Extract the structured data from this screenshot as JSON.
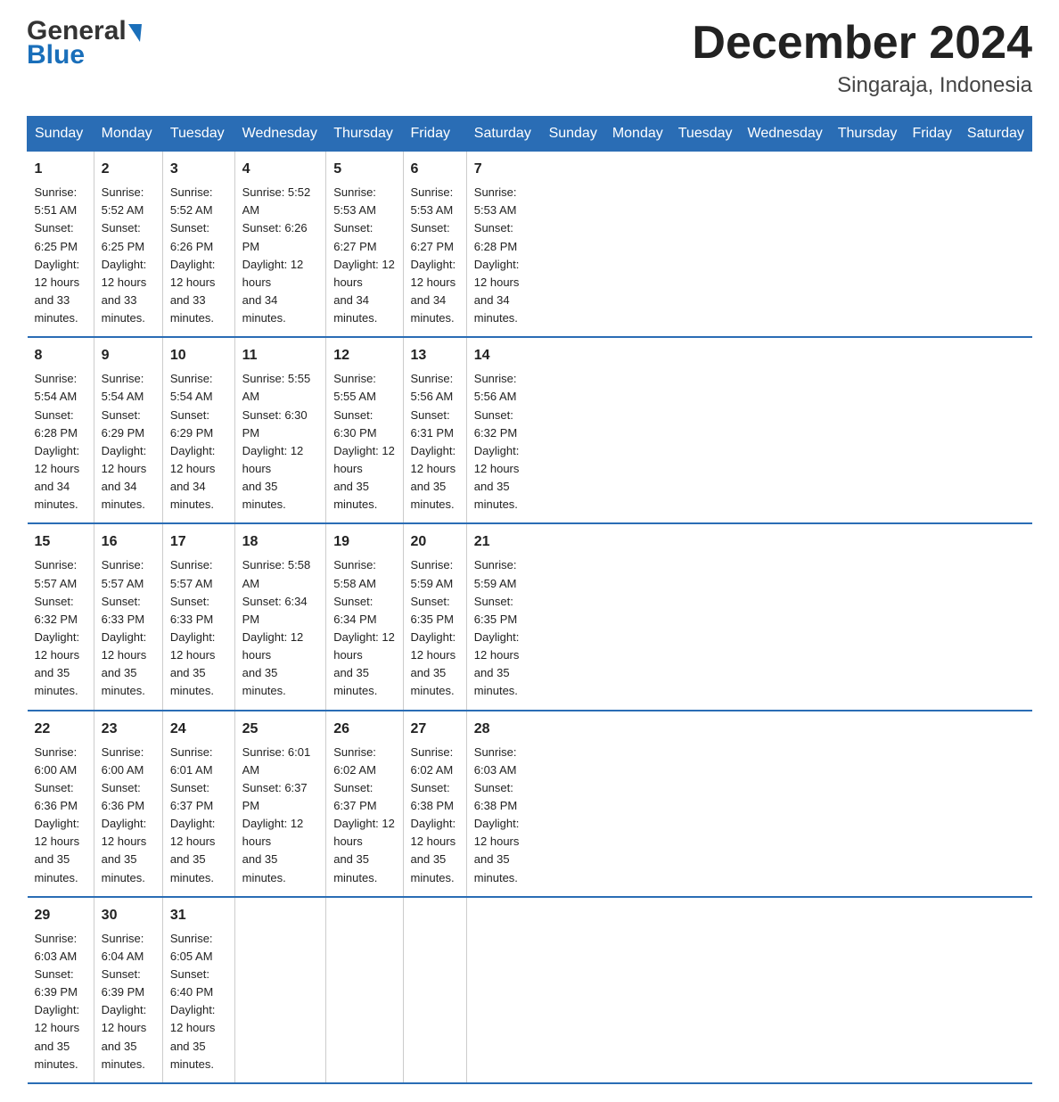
{
  "logo": {
    "general": "General",
    "blue": "Blue"
  },
  "title": "December 2024",
  "subtitle": "Singaraja, Indonesia",
  "days_of_week": [
    "Sunday",
    "Monday",
    "Tuesday",
    "Wednesday",
    "Thursday",
    "Friday",
    "Saturday"
  ],
  "weeks": [
    [
      {
        "num": "1",
        "info": "Sunrise: 5:51 AM\nSunset: 6:25 PM\nDaylight: 12 hours\nand 33 minutes."
      },
      {
        "num": "2",
        "info": "Sunrise: 5:52 AM\nSunset: 6:25 PM\nDaylight: 12 hours\nand 33 minutes."
      },
      {
        "num": "3",
        "info": "Sunrise: 5:52 AM\nSunset: 6:26 PM\nDaylight: 12 hours\nand 33 minutes."
      },
      {
        "num": "4",
        "info": "Sunrise: 5:52 AM\nSunset: 6:26 PM\nDaylight: 12 hours\nand 34 minutes."
      },
      {
        "num": "5",
        "info": "Sunrise: 5:53 AM\nSunset: 6:27 PM\nDaylight: 12 hours\nand 34 minutes."
      },
      {
        "num": "6",
        "info": "Sunrise: 5:53 AM\nSunset: 6:27 PM\nDaylight: 12 hours\nand 34 minutes."
      },
      {
        "num": "7",
        "info": "Sunrise: 5:53 AM\nSunset: 6:28 PM\nDaylight: 12 hours\nand 34 minutes."
      }
    ],
    [
      {
        "num": "8",
        "info": "Sunrise: 5:54 AM\nSunset: 6:28 PM\nDaylight: 12 hours\nand 34 minutes."
      },
      {
        "num": "9",
        "info": "Sunrise: 5:54 AM\nSunset: 6:29 PM\nDaylight: 12 hours\nand 34 minutes."
      },
      {
        "num": "10",
        "info": "Sunrise: 5:54 AM\nSunset: 6:29 PM\nDaylight: 12 hours\nand 34 minutes."
      },
      {
        "num": "11",
        "info": "Sunrise: 5:55 AM\nSunset: 6:30 PM\nDaylight: 12 hours\nand 35 minutes."
      },
      {
        "num": "12",
        "info": "Sunrise: 5:55 AM\nSunset: 6:30 PM\nDaylight: 12 hours\nand 35 minutes."
      },
      {
        "num": "13",
        "info": "Sunrise: 5:56 AM\nSunset: 6:31 PM\nDaylight: 12 hours\nand 35 minutes."
      },
      {
        "num": "14",
        "info": "Sunrise: 5:56 AM\nSunset: 6:32 PM\nDaylight: 12 hours\nand 35 minutes."
      }
    ],
    [
      {
        "num": "15",
        "info": "Sunrise: 5:57 AM\nSunset: 6:32 PM\nDaylight: 12 hours\nand 35 minutes."
      },
      {
        "num": "16",
        "info": "Sunrise: 5:57 AM\nSunset: 6:33 PM\nDaylight: 12 hours\nand 35 minutes."
      },
      {
        "num": "17",
        "info": "Sunrise: 5:57 AM\nSunset: 6:33 PM\nDaylight: 12 hours\nand 35 minutes."
      },
      {
        "num": "18",
        "info": "Sunrise: 5:58 AM\nSunset: 6:34 PM\nDaylight: 12 hours\nand 35 minutes."
      },
      {
        "num": "19",
        "info": "Sunrise: 5:58 AM\nSunset: 6:34 PM\nDaylight: 12 hours\nand 35 minutes."
      },
      {
        "num": "20",
        "info": "Sunrise: 5:59 AM\nSunset: 6:35 PM\nDaylight: 12 hours\nand 35 minutes."
      },
      {
        "num": "21",
        "info": "Sunrise: 5:59 AM\nSunset: 6:35 PM\nDaylight: 12 hours\nand 35 minutes."
      }
    ],
    [
      {
        "num": "22",
        "info": "Sunrise: 6:00 AM\nSunset: 6:36 PM\nDaylight: 12 hours\nand 35 minutes."
      },
      {
        "num": "23",
        "info": "Sunrise: 6:00 AM\nSunset: 6:36 PM\nDaylight: 12 hours\nand 35 minutes."
      },
      {
        "num": "24",
        "info": "Sunrise: 6:01 AM\nSunset: 6:37 PM\nDaylight: 12 hours\nand 35 minutes."
      },
      {
        "num": "25",
        "info": "Sunrise: 6:01 AM\nSunset: 6:37 PM\nDaylight: 12 hours\nand 35 minutes."
      },
      {
        "num": "26",
        "info": "Sunrise: 6:02 AM\nSunset: 6:37 PM\nDaylight: 12 hours\nand 35 minutes."
      },
      {
        "num": "27",
        "info": "Sunrise: 6:02 AM\nSunset: 6:38 PM\nDaylight: 12 hours\nand 35 minutes."
      },
      {
        "num": "28",
        "info": "Sunrise: 6:03 AM\nSunset: 6:38 PM\nDaylight: 12 hours\nand 35 minutes."
      }
    ],
    [
      {
        "num": "29",
        "info": "Sunrise: 6:03 AM\nSunset: 6:39 PM\nDaylight: 12 hours\nand 35 minutes."
      },
      {
        "num": "30",
        "info": "Sunrise: 6:04 AM\nSunset: 6:39 PM\nDaylight: 12 hours\nand 35 minutes."
      },
      {
        "num": "31",
        "info": "Sunrise: 6:05 AM\nSunset: 6:40 PM\nDaylight: 12 hours\nand 35 minutes."
      },
      {
        "num": "",
        "info": ""
      },
      {
        "num": "",
        "info": ""
      },
      {
        "num": "",
        "info": ""
      },
      {
        "num": "",
        "info": ""
      }
    ]
  ]
}
